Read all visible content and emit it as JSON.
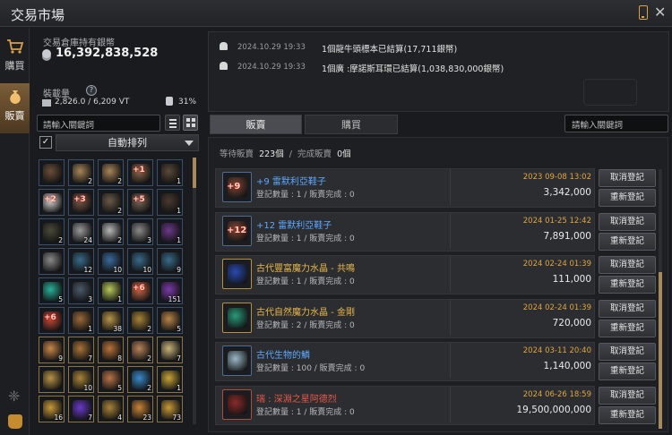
{
  "window": {
    "title": "交易市場",
    "phone_icon": "phone-icon",
    "close_label": "✕"
  },
  "sidenav": {
    "buy_label": "購買",
    "sell_label": "販賣",
    "buy_icon": "cart-icon",
    "sell_icon": "money-bag-icon"
  },
  "wallet": {
    "label": "交易倉庫持有銀幣",
    "amount": "16,392,838,528"
  },
  "weight": {
    "label": "裝載量",
    "help": "?",
    "value": "2,826.0 / 6,209 VT",
    "slot_value": "31%"
  },
  "left_search": {
    "placeholder": "請輸入關鍵詞"
  },
  "sort": {
    "label": "自動排列",
    "checked_glyph": "✓"
  },
  "inventory": [
    {
      "color": "#6a4f3a",
      "count": "",
      "enh": ""
    },
    {
      "color": "#a8865a",
      "count": "2",
      "enh": ""
    },
    {
      "color": "#a8865a",
      "count": "2",
      "enh": ""
    },
    {
      "color": "#8a6a4f",
      "count": "",
      "enh": "+1"
    },
    {
      "color": "#5a4a3a",
      "count": "1",
      "enh": ""
    },
    {
      "color": "#d8d8d8",
      "count": "",
      "enh": "+2"
    },
    {
      "color": "#7a5a4a",
      "count": "",
      "enh": "+3"
    },
    {
      "color": "#6a5a4a",
      "count": "2",
      "enh": ""
    },
    {
      "color": "#7a6a5a",
      "count": "",
      "enh": "+5"
    },
    {
      "color": "#4a3a30",
      "count": "1",
      "enh": ""
    },
    {
      "color": "#4a4a3a",
      "count": "2",
      "enh": ""
    },
    {
      "color": "#9a9a9a",
      "count": "24",
      "enh": ""
    },
    {
      "color": "#b8b8b8",
      "count": "2",
      "enh": ""
    },
    {
      "color": "#8a8a8a",
      "count": "3",
      "enh": ""
    },
    {
      "color": "#6a3a8a",
      "count": "1",
      "enh": ""
    },
    {
      "color": "#8a8a8a",
      "count": "",
      "enh": ""
    },
    {
      "color": "#3a6a8a",
      "count": "12",
      "enh": ""
    },
    {
      "color": "#3a6a9a",
      "count": "10",
      "enh": ""
    },
    {
      "color": "#3a6a8a",
      "count": "10",
      "enh": ""
    },
    {
      "color": "#3a6a8a",
      "count": "9",
      "enh": ""
    },
    {
      "color": "#2ab09a",
      "count": "5",
      "enh": ""
    },
    {
      "color": "#4a5a6a",
      "count": "3",
      "enh": ""
    },
    {
      "color": "#b8c85a",
      "count": "1",
      "enh": ""
    },
    {
      "color": "#c86a4a",
      "count": "",
      "enh": "+6"
    },
    {
      "color": "#7a3aa8",
      "count": "151",
      "enh": ""
    },
    {
      "color": "#c84a3a",
      "count": "",
      "enh": "+6"
    },
    {
      "color": "#9a6a3a",
      "count": "1",
      "enh": ""
    },
    {
      "color": "#b8944a",
      "count": "38",
      "enh": ""
    },
    {
      "color": "#a8843a",
      "count": "2",
      "enh": ""
    },
    {
      "color": "#b8844a",
      "count": "5",
      "enh": ""
    },
    {
      "color": "#c8884a",
      "count": "9",
      "enh": ""
    },
    {
      "color": "#a8743a",
      "count": "7",
      "enh": ""
    },
    {
      "color": "#b8743a",
      "count": "8",
      "enh": ""
    },
    {
      "color": "#b8845a",
      "count": "2",
      "enh": ""
    },
    {
      "color": "#c8b47a",
      "count": "7",
      "enh": ""
    },
    {
      "color": "#b8944a",
      "count": "",
      "enh": ""
    },
    {
      "color": "#a8843a",
      "count": "10",
      "enh": ""
    },
    {
      "color": "#b8744a",
      "count": "5",
      "enh": ""
    },
    {
      "color": "#3a8ac8",
      "count": "2",
      "enh": ""
    },
    {
      "color": "#c8a43a",
      "count": "1",
      "enh": ""
    },
    {
      "color": "#c89a3a",
      "count": "16",
      "enh": ""
    },
    {
      "color": "#6a3ac8",
      "count": "7",
      "enh": ""
    },
    {
      "color": "#a8843a",
      "count": "4",
      "enh": ""
    },
    {
      "color": "#c8843a",
      "count": "23",
      "enh": ""
    },
    {
      "color": "#c89a3a",
      "count": "73",
      "enh": ""
    }
  ],
  "notifications": [
    {
      "date": "2024.10.29  19:33",
      "message": "1個龍牛頭標本已結算(17,711銀幣)"
    },
    {
      "date": "2024.10.29  19:33",
      "message": "1個廣 :摩諾斯耳環已結算(1,038,830,000銀幣)"
    }
  ],
  "tabs": {
    "sell": "販賣",
    "buy": "購買"
  },
  "right_search": {
    "placeholder": "請輸入關鍵詞"
  },
  "summary": {
    "pending_label": "等待販賣",
    "pending_count": "223個",
    "sep": "/",
    "done_label": "完成販賣",
    "done_count": "0個"
  },
  "listings": [
    {
      "name": "+9 雷默利亞鞋子",
      "name_color": "#5ea8ff",
      "info": "登記數量 : 1 / 販賣完成 : 0",
      "time": "2023 09-08 13:02",
      "price": "3,342,000",
      "icon_color": "#7a4a3a",
      "frame": "blue",
      "enh": "+9"
    },
    {
      "name": "+12 雷默利亞鞋子",
      "name_color": "#5ea8ff",
      "info": "登記數量 : 1 / 販賣完成 : 0",
      "time": "2024 01-25 12:42",
      "price": "7,891,000",
      "icon_color": "#7a4a3a",
      "frame": "blue",
      "enh": "+12"
    },
    {
      "name": "古代豐富魔力水晶 - 共鳴",
      "name_color": "#e8b84a",
      "info": "登記數量 : 1 / 販賣完成 : 0",
      "time": "2024 02-24 01:39",
      "price": "111,000",
      "icon_color": "#2a4ab0",
      "frame": "gold",
      "enh": ""
    },
    {
      "name": "古代自然魔力水晶 - 金剛",
      "name_color": "#e8b84a",
      "info": "登記數量 : 2 / 販賣完成 : 0",
      "time": "2024 02-24 01:39",
      "price": "720,000",
      "icon_color": "#2a9a7a",
      "frame": "gold",
      "enh": ""
    },
    {
      "name": "古代生物的鱗",
      "name_color": "#5ea8ff",
      "info": "登記數量 : 100 / 販賣完成 : 0",
      "time": "2024 03-11 20:40",
      "price": "1,140,000",
      "icon_color": "#9ab8c8",
      "frame": "blue",
      "enh": ""
    },
    {
      "name": "瑞 : 深淵之星阿德烈",
      "name_color": "#e8584a",
      "info": "登記數量 : 1 / 販賣完成 : 0",
      "time": "2024 06-26 18:59",
      "price": "19,500,000,000",
      "icon_color": "#8a2a2a",
      "frame": "red",
      "enh": ""
    }
  ],
  "buttons": {
    "cancel": "取消登記",
    "reregister": "重新登記"
  }
}
